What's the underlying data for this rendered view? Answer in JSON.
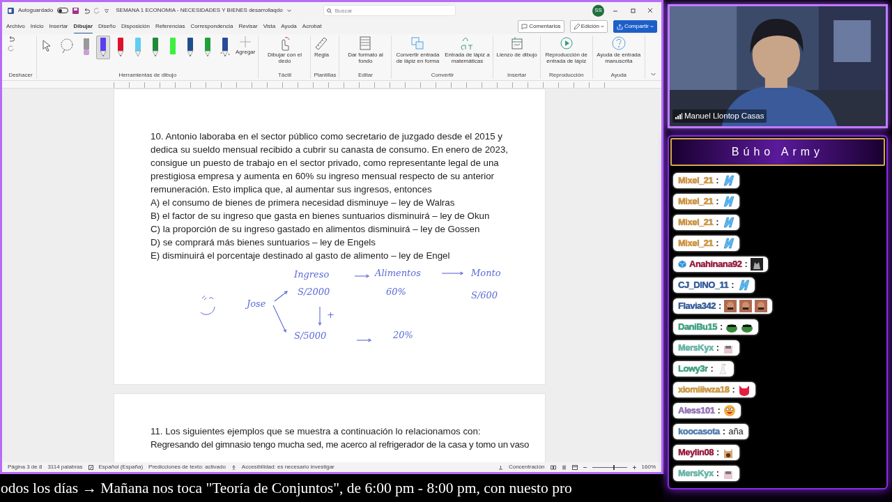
{
  "word": {
    "autosave_label": "Autoguardado",
    "autosave_on": false,
    "title": "SEMANA 1 ECONOMIA - NECESIDADES Y BIENES desarrollaqdo",
    "search": {
      "placeholder": "Buscar"
    },
    "avatar": "SS",
    "tabs": [
      {
        "label": "Archivo",
        "selected": false
      },
      {
        "label": "Inicio",
        "selected": false
      },
      {
        "label": "Insertar",
        "selected": false
      },
      {
        "label": "Dibujar",
        "selected": true
      },
      {
        "label": "Diseño",
        "selected": false
      },
      {
        "label": "Disposición",
        "selected": false
      },
      {
        "label": "Referencias",
        "selected": false
      },
      {
        "label": "Correspondencia",
        "selected": false
      },
      {
        "label": "Revisar",
        "selected": false
      },
      {
        "label": "Vista",
        "selected": false
      },
      {
        "label": "Ayuda",
        "selected": false
      },
      {
        "label": "Acrobat",
        "selected": false
      }
    ],
    "actions": [
      {
        "kind": "comments",
        "label": "Comentarios"
      },
      {
        "kind": "editing",
        "label": "Edición"
      },
      {
        "kind": "share",
        "label": "Compartir"
      }
    ],
    "ribbon": [
      {
        "kind": "undo",
        "label": "Deshacer"
      },
      {
        "kind": "tools",
        "label": "Herramientas de dibujo",
        "add_label": "Agregar",
        "tools": [
          {
            "kind": "select",
            "selected": false
          },
          {
            "kind": "lasso",
            "selected": false
          },
          {
            "kind": "eraser",
            "selected": false
          },
          {
            "kind": "pen",
            "color": "#5b3cf0",
            "selected": true
          },
          {
            "kind": "pen",
            "color": "#e0102c",
            "selected": false
          },
          {
            "kind": "pen",
            "color": "#5ccff0",
            "selected": false
          },
          {
            "kind": "pen",
            "color": "#1f8a3a",
            "selected": false
          },
          {
            "kind": "highlighter",
            "color": "#3cf03c",
            "selected": false
          },
          {
            "kind": "pen",
            "color": "#1f4f8a",
            "selected": false
          },
          {
            "kind": "pen",
            "color": "#1fa03a",
            "selected": false
          },
          {
            "kind": "galaxy",
            "color": "#2a4a9a",
            "selected": false
          }
        ]
      },
      {
        "kind": "buttons",
        "label": "Táctil",
        "buttons": [
          {
            "label": "Dibujar con el dedo"
          }
        ]
      },
      {
        "kind": "buttons",
        "label": "Plantillas",
        "buttons": [
          {
            "label": "Regla"
          }
        ]
      },
      {
        "kind": "buttons",
        "label": "Editar",
        "buttons": [
          {
            "label": "Dar formato al fondo"
          }
        ]
      },
      {
        "kind": "buttons",
        "label": "Convertir",
        "buttons": [
          {
            "label": "Convertir entrada de lápiz en forma"
          },
          {
            "label": "Entrada de lápiz a matemáticas"
          }
        ]
      },
      {
        "kind": "buttons",
        "label": "Insertar",
        "buttons": [
          {
            "label": "Lienzo de dibujo"
          }
        ]
      },
      {
        "kind": "buttons",
        "label": "Reproducción",
        "buttons": [
          {
            "label": "Reproducción de entrada de lápiz"
          }
        ]
      },
      {
        "kind": "buttons",
        "label": "Ayuda",
        "buttons": [
          {
            "label": "Ayuda de entrada manuscrita"
          }
        ]
      }
    ],
    "question10": {
      "stem": "10. Antonio laboraba en el sector público como secretario de juzgado desde el 2015 y dedica su sueldo mensual recibido a cubrir su canasta de consumo. En enero de 2023, consigue un puesto de trabajo en el sector privado, como representante legal de una prestigiosa empresa y aumenta en 60% su ingreso mensual respecto de su anterior remuneración. Esto implica que, al aumentar sus ingresos, entonces",
      "options": [
        "A) el consumo de bienes de primera necesidad disminuye – ley de Walras",
        "B) el factor de su ingreso que gasta en bienes suntuarios disminuirá – ley de Okun",
        "C) la proporción de su ingreso gastado en alimentos disminuirá – ley de Gossen",
        "D) se comprará más bienes suntuarios – ley de Engels",
        "E) disminuirá el porcentaje destinado al gasto de alimento – ley de Engel"
      ]
    },
    "ink_notes": [
      "Ingreso",
      "Alimentos",
      "Monto",
      "S/2000",
      "60%",
      "S/600",
      "Jose",
      "+",
      "S/5000",
      "20%"
    ],
    "question11": {
      "stem": "11. Los siguientes ejemplos que se muestra a continuación lo relacionamos con:",
      "line": "Regresando del gimnasio tengo mucha sed, me acerco al refrigerador de la casa y tomo un vaso"
    },
    "status_bar": {
      "page": "Página 3 de 8",
      "words": "3114 palabras",
      "language": "Español (España)",
      "predictions": "Predicciones de texto: activado",
      "accessibility": "Accesibilidad: es necesario investigar",
      "focus": "Concentración",
      "zoom": "160%",
      "zoom_level": {
        "level": 0.6
      }
    }
  },
  "ticker": "odos los días → Mañana nos toca \"Teoría de Conjuntos\", de 6:00 pm - 8:00 pm, con nuesto pro",
  "webcam": {
    "name": "Manuel Llontop Casas"
  },
  "chat": {
    "title": "Búho Army",
    "messages": [
      {
        "user": "Mixel_21",
        "color": "#e89a2c",
        "badge": false,
        "separator": ":",
        "emotes": [
          {
            "kind": "crystal"
          }
        ]
      },
      {
        "user": "Mixel_21",
        "color": "#e89a2c",
        "badge": false,
        "separator": ":",
        "emotes": [
          {
            "kind": "crystal"
          }
        ]
      },
      {
        "user": "Mixel_21",
        "color": "#e89a2c",
        "badge": false,
        "separator": ":",
        "emotes": [
          {
            "kind": "crystal"
          }
        ]
      },
      {
        "user": "Mixel_21",
        "color": "#e89a2c",
        "badge": false,
        "separator": ":",
        "emotes": [
          {
            "kind": "crystal"
          }
        ]
      },
      {
        "user": "Anahinana92",
        "color": "#b0103a",
        "badge": true,
        "separator": ":",
        "emotes": [
          {
            "kind": "wolf"
          }
        ]
      },
      {
        "user": "CJ_DINO_11",
        "color": "#2f5fb0",
        "badge": false,
        "separator": ":",
        "emotes": [
          {
            "kind": "crystal"
          }
        ]
      },
      {
        "user": "Flavia342",
        "color": "#2f5fb0",
        "badge": false,
        "separator": ":",
        "emotes": [
          {
            "kind": "laugh"
          },
          {
            "kind": "laugh"
          },
          {
            "kind": "laugh"
          }
        ]
      },
      {
        "user": "DaniBu15",
        "color": "#2fb088",
        "badge": false,
        "separator": ":",
        "emotes": [
          {
            "kind": "frog"
          },
          {
            "kind": "frog"
          }
        ]
      },
      {
        "user": "MersKyx",
        "color": "#5fc8b8",
        "badge": false,
        "separator": ":",
        "emotes": [
          {
            "kind": "cat"
          }
        ]
      },
      {
        "user": "Lowy3r",
        "color": "#2fb088",
        "badge": false,
        "separator": ":",
        "emotes": [
          {
            "kind": "goose"
          }
        ]
      },
      {
        "user": "xiomiiiwza18",
        "color": "#e8a02c",
        "badge": false,
        "separator": ":",
        "emotes": [
          {
            "kind": "devil"
          }
        ]
      },
      {
        "user": "Aless101",
        "color": "#a070d0",
        "badge": false,
        "separator": ":",
        "emotes": [
          {
            "kind": "smiley"
          }
        ]
      },
      {
        "user": "koocasota",
        "color": "#4a88c8",
        "badge": false,
        "separator": ":",
        "text": "aña"
      },
      {
        "user": "Meylin08",
        "color": "#b0103a",
        "badge": false,
        "separator": ":",
        "emotes": [
          {
            "kind": "popcat"
          }
        ]
      },
      {
        "user": "MersKyx",
        "color": "#5fc8b8",
        "badge": false,
        "separator": ":",
        "emotes": [
          {
            "kind": "cat"
          }
        ]
      }
    ]
  }
}
